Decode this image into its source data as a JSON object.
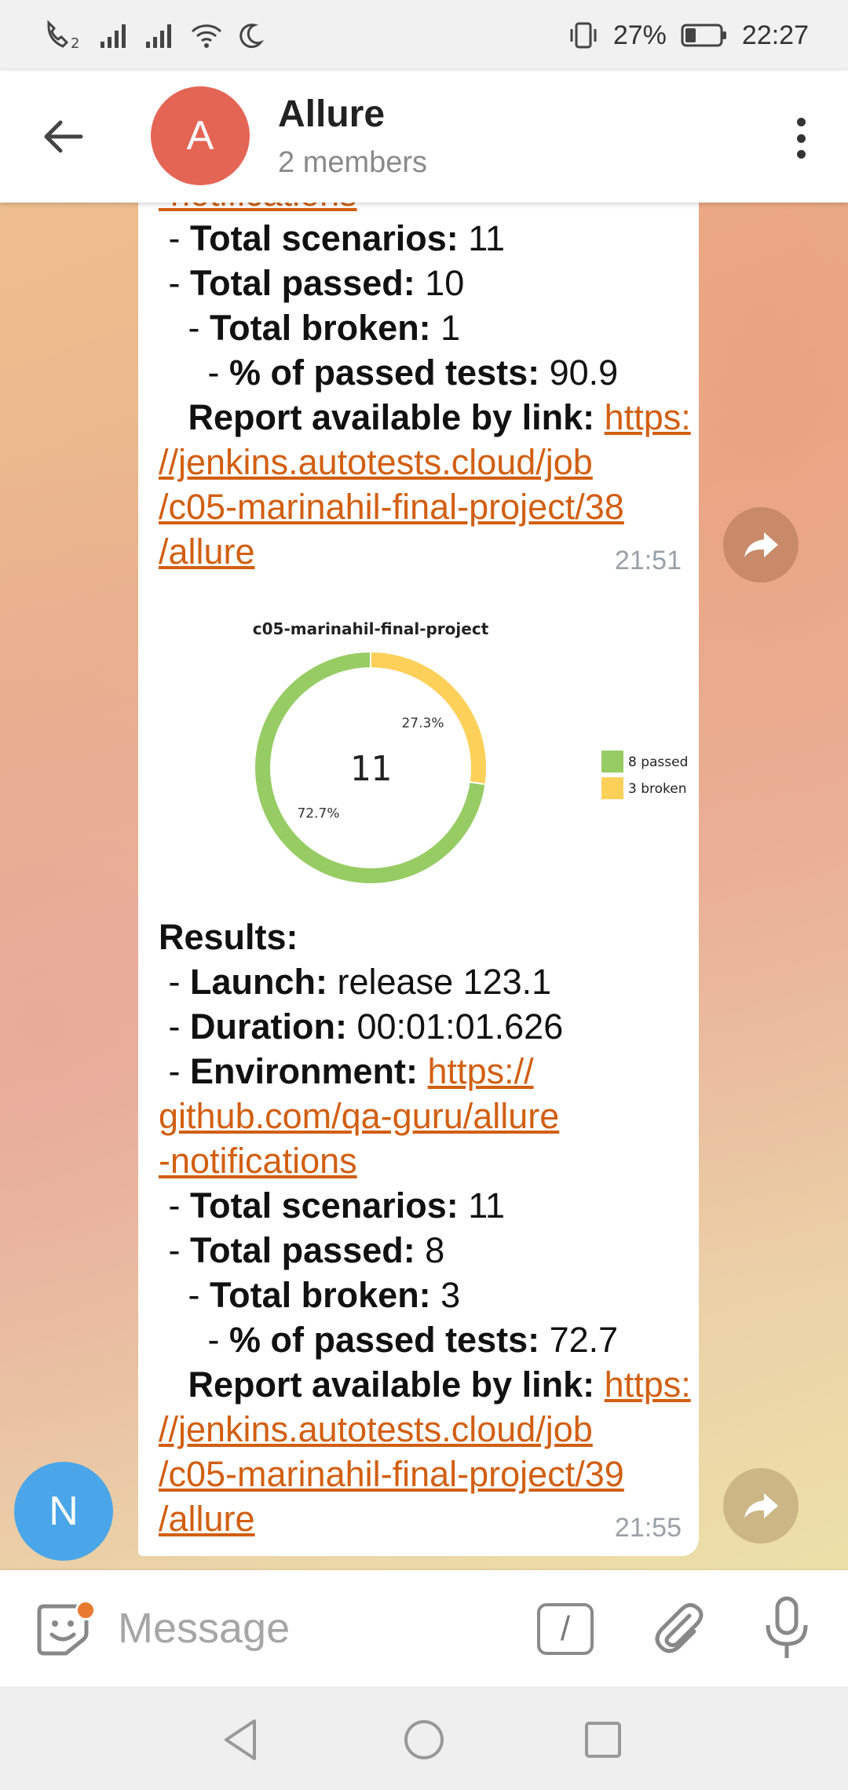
{
  "status_bar": {
    "sim2_label": "2",
    "battery_percent": "27%",
    "time": "22:27",
    "icons": [
      "wifi-call-icon",
      "signal-icon",
      "signal-icon",
      "wifi-icon",
      "moon-icon",
      "vibrate-icon",
      "battery-icon"
    ]
  },
  "header": {
    "avatar_letter": "A",
    "title": "Allure",
    "subtitle": "2 members",
    "avatar_color": "#e56555"
  },
  "messages": [
    {
      "partial_top_link": "-notifications",
      "total_scenarios_label": "Total scenarios:",
      "total_scenarios_value": " 11",
      "total_passed_label": "Total passed:",
      "total_passed_value": " 10",
      "total_broken_label": "Total broken:",
      "total_broken_value": " 1",
      "percent_label": "% of passed tests:",
      "percent_value": " 90.9",
      "report_label": "Report available by link: ",
      "report_link_lines": [
        "https:",
        "//jenkins.autotests.cloud/job",
        "/c05-marinahil-final-project/38",
        "/allure"
      ],
      "time": "21:51"
    },
    {
      "results_label": "Results:",
      "launch_label": "Launch:",
      "launch_value": " release 123.1",
      "duration_label": "Duration:",
      "duration_value": " 00:01:01.626",
      "environment_label": "Environment: ",
      "environment_link_lines": [
        "https://",
        "github.com/qa-guru/allure",
        "-notifications"
      ],
      "total_scenarios_label": "Total scenarios:",
      "total_scenarios_value": " 11",
      "total_passed_label": "Total passed:",
      "total_passed_value": " 8",
      "total_broken_label": "Total broken:",
      "total_broken_value": " 3",
      "percent_label": "% of passed tests:",
      "percent_value": " 72.7",
      "report_label": "Report available by link: ",
      "report_link_lines": [
        "https:",
        "//jenkins.autotests.cloud/job",
        "/c05-marinahil-final-project/39",
        "/allure"
      ],
      "time": "21:55",
      "sender_avatar_letter": "N",
      "sender_avatar_color": "#4aa6e8"
    }
  ],
  "chart_data": {
    "type": "pie",
    "title": "c05-marinahil-final-project",
    "center_label": "11",
    "categories": [
      "8 passed",
      "3 broken"
    ],
    "values": [
      8,
      3
    ],
    "percent_labels": [
      "72.7%",
      "27.3%"
    ],
    "colors": [
      "#97cc64",
      "#fdd05a"
    ],
    "legend_position": "right"
  },
  "input": {
    "placeholder": "Message"
  },
  "colors": {
    "link": "#d25f12",
    "forward_button_1": "#c98a6a",
    "forward_button_2": "#cdb686"
  }
}
